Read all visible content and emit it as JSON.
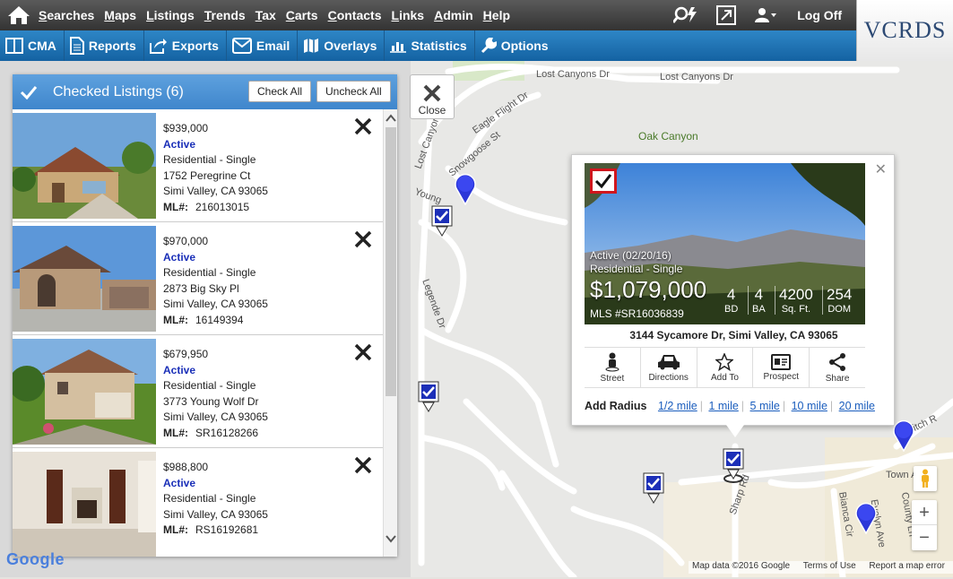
{
  "nav": {
    "items": [
      "Searches",
      "Maps",
      "Listings",
      "Trends",
      "Tax",
      "Carts",
      "Contacts",
      "Links",
      "Admin",
      "Help"
    ],
    "logoff_label": "Log Off"
  },
  "logo": {
    "text": "VCRDS"
  },
  "toolbar": {
    "items": [
      {
        "label": "CMA",
        "icon": "book-icon"
      },
      {
        "label": "Reports",
        "icon": "document-icon"
      },
      {
        "label": "Exports",
        "icon": "export-icon"
      },
      {
        "label": "Email",
        "icon": "envelope-icon"
      },
      {
        "label": "Overlays",
        "icon": "map-icon"
      },
      {
        "label": "Statistics",
        "icon": "bar-chart-icon"
      },
      {
        "label": "Options",
        "icon": "wrench-icon"
      }
    ]
  },
  "panel": {
    "title": "Checked Listings (6)",
    "check_all": "Check All",
    "uncheck_all": "Uncheck All",
    "ml_label": "ML#:",
    "listings": [
      {
        "price": "$939,000",
        "status": "Active",
        "type": "Residential - Single",
        "street": "1752 Peregrine Ct",
        "city": "Simi Valley, CA 93065",
        "ml": "216013015"
      },
      {
        "price": "$970,000",
        "status": "Active",
        "type": "Residential - Single",
        "street": "2873 Big Sky Pl",
        "city": "Simi Valley, CA 93065",
        "ml": "16149394"
      },
      {
        "price": "$679,950",
        "status": "Active",
        "type": "Residential - Single",
        "street": "3773 Young Wolf Dr",
        "city": "Simi Valley, CA 93065",
        "ml": "SR16128266"
      },
      {
        "price": "$988,800",
        "status": "Active",
        "type": "Residential - Single",
        "street": "",
        "city": "Simi Valley, CA 93065",
        "ml": "RS16192681"
      }
    ]
  },
  "close_button": {
    "label": "Close"
  },
  "popup": {
    "status": "Active (02/20/16)",
    "type": "Residential - Single",
    "price": "$1,079,000",
    "mls": "MLS #SR16036839",
    "stats": [
      {
        "value": "4",
        "label": "BD"
      },
      {
        "value": "4",
        "label": "BA"
      },
      {
        "value": "4200",
        "label": "Sq. Ft."
      },
      {
        "value": "254",
        "label": "DOM"
      }
    ],
    "address": "3144 Sycamore Dr, Simi Valley, CA 93065",
    "actions": [
      {
        "label": "Street",
        "icon": "person-icon"
      },
      {
        "label": "Directions",
        "icon": "car-icon"
      },
      {
        "label": "Add To",
        "icon": "star-icon"
      },
      {
        "label": "Prospect",
        "icon": "id-card-icon"
      },
      {
        "label": "Share",
        "icon": "share-icon"
      }
    ],
    "radius_label": "Add Radius",
    "radius_options": [
      "1/2 mile",
      "1 mile",
      "5 mile",
      "10 mile",
      "20 mile"
    ]
  },
  "map": {
    "roads": [
      "Lost Canyons Dr",
      "Lost Canyons Dr",
      "Eagle Flight Dr",
      "Snowgoose St",
      "Oak Canyon",
      "Lost Canyon",
      "Young",
      "Legende Dr",
      "Sharp Rd",
      "Town Av",
      "Ditch R",
      "Bianca Cir",
      "Evelyn Ave",
      "County Ln"
    ],
    "footer": [
      "Map data ©2016 Google",
      "Terms of Use",
      "Report a map error"
    ],
    "google_logo": "Google",
    "zoom_in": "+",
    "zoom_out": "−"
  }
}
